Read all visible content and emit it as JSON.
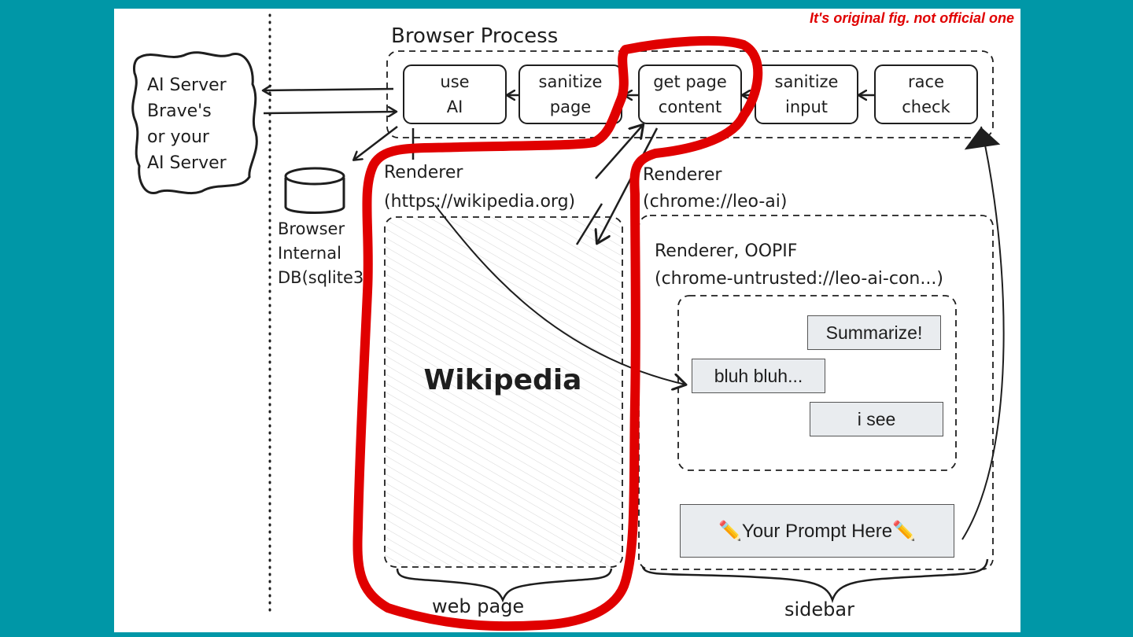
{
  "note": "It's original fig. not official one",
  "browser_process": {
    "title": "Browser Process",
    "steps": [
      {
        "line1": "use",
        "line2": "AI"
      },
      {
        "line1": "sanitize",
        "line2": "page"
      },
      {
        "line1": "get page",
        "line2": "content"
      },
      {
        "line1": "sanitize",
        "line2": "input"
      },
      {
        "line1": "race",
        "line2": "check"
      }
    ]
  },
  "ai_server": {
    "lines": [
      "AI Server",
      "Brave's",
      "or your",
      "AI Server"
    ]
  },
  "db": {
    "lines": [
      "Browser",
      "Internal",
      "DB(sqlite3)"
    ]
  },
  "renderer_web": {
    "line1": "Renderer",
    "line2": "(https://wikipedia.org)",
    "content": "Wikipedia"
  },
  "renderer_side": {
    "line1": "Renderer",
    "line2": "(chrome://leo-ai)"
  },
  "oopif": {
    "line1": "Renderer, OOPIF",
    "line2": "(chrome-untrusted://leo-ai-con...)"
  },
  "chat": {
    "summarize": "Summarize!",
    "bluh": "bluh bluh...",
    "isee": "i see"
  },
  "prompt": "✏️Your Prompt Here✏️",
  "labels": {
    "web_page": "web page",
    "sidebar": "sidebar"
  },
  "colors": {
    "background": "#0097a7",
    "highlight": "#e00000",
    "stroke": "#1e1e1e"
  }
}
